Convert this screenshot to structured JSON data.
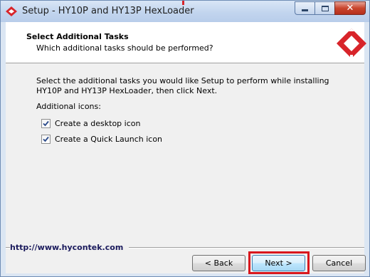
{
  "window": {
    "title": "Setup - HY10P and HY13P HexLoader",
    "controls": {
      "minimize": "minimize-icon",
      "maximize": "maximize-icon",
      "close": "close-icon"
    }
  },
  "header": {
    "title": "Select Additional Tasks",
    "subtitle": "Which additional tasks should be performed?",
    "logo": "hycontek-logo"
  },
  "body": {
    "description": "Select the additional tasks you would like Setup to perform while installing HY10P and HY13P HexLoader, then click Next.",
    "group_label": "Additional icons:",
    "tasks": [
      {
        "label": "Create a desktop icon",
        "checked": true
      },
      {
        "label": "Create a Quick Launch icon",
        "checked": true
      }
    ]
  },
  "footer": {
    "url": "http://www.hycontek.com",
    "back_label": "< Back",
    "next_label": "Next >",
    "cancel_label": "Cancel"
  },
  "colors": {
    "brand_red": "#d8242a",
    "highlight": "#d8171d",
    "title_bar": "#c2d5ee"
  }
}
